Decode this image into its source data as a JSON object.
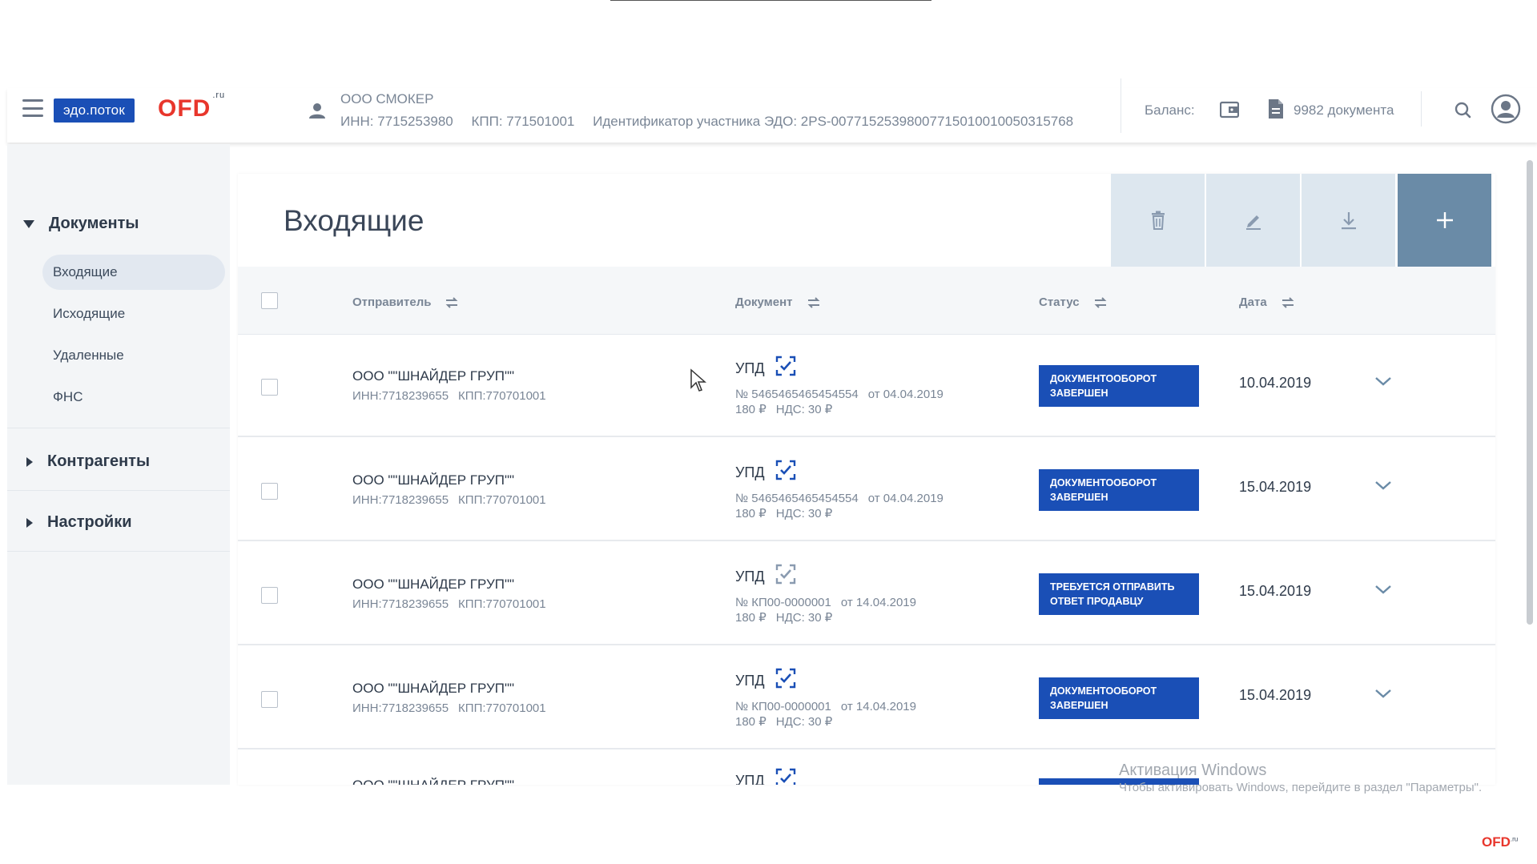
{
  "header": {
    "logo_edo": "эдо.поток",
    "logo_ofd": "OFD",
    "logo_ofd_suffix": ".ru",
    "org_name": "ООО СМОКЕР",
    "inn": "ИНН: 7715253980",
    "kpp": "КПП: 771501001",
    "edo_id": "Идентификатор участника ЭДО: 2PS-0077152539800771501001005031576​8",
    "balance_label": "Баланс:",
    "doc_count": "9982 документа"
  },
  "sidebar": {
    "documents": "Документы",
    "items": [
      {
        "label": "Входящие",
        "active": true
      },
      {
        "label": "Исходящие",
        "active": false
      },
      {
        "label": "Удаленные",
        "active": false
      },
      {
        "label": "ФНС",
        "active": false
      }
    ],
    "contractors": "Контрагенты",
    "settings": "Настройки"
  },
  "main": {
    "title": "Входящие",
    "columns": {
      "sender": "Отправитель",
      "document": "Документ",
      "status": "Статус",
      "date": "Дата"
    },
    "rows": [
      {
        "sender": "ООО \"\"ШНАЙДЕР ГРУП\"\"",
        "inn": "ИНН:7718239655",
        "kpp": "КПП:770701001",
        "doc_type": "УПД",
        "doc_num": "№ 5465465465454554",
        "doc_date": "от 04.04.2019",
        "amount": "180 ₽",
        "vat": "НДС: 30 ₽",
        "status_line1": "Документооборот",
        "status_line2": "завершен",
        "date": "10.04.2019"
      },
      {
        "sender": "ООО \"\"ШНАЙДЕР ГРУП\"\"",
        "inn": "ИНН:7718239655",
        "kpp": "КПП:770701001",
        "doc_type": "УПД",
        "doc_num": "№ 5465465465454554",
        "doc_date": "от 04.04.2019",
        "amount": "180 ₽",
        "vat": "НДС: 30 ₽",
        "status_line1": "Документооборот",
        "status_line2": "завершен",
        "date": "15.04.2019"
      },
      {
        "sender": "ООО \"\"ШНАЙДЕР ГРУП\"\"",
        "inn": "ИНН:7718239655",
        "kpp": "КПП:770701001",
        "doc_type": "УПД",
        "doc_num": "№ КП00-0000001",
        "doc_date": "от 14.04.2019",
        "amount": "180 ₽",
        "vat": "НДС: 30 ₽",
        "status_line1": "Требуется отправить",
        "status_line2": "ответ продавцу",
        "date": "15.04.2019"
      },
      {
        "sender": "ООО \"\"ШНАЙДЕР ГРУП\"\"",
        "inn": "ИНН:7718239655",
        "kpp": "КПП:770701001",
        "doc_type": "УПД",
        "doc_num": "№ КП00-0000001",
        "doc_date": "от 14.04.2019",
        "amount": "180 ₽",
        "vat": "НДС: 30 ₽",
        "status_line1": "Документооборот",
        "status_line2": "завершен",
        "date": "15.04.2019"
      }
    ],
    "partial_row": {
      "sender": "ООО \"\"ШНАЙДЕР ГРУП\"\"",
      "doc_type": "УПД"
    }
  },
  "watermark": {
    "title": "Активация Windows",
    "subtitle": "Чтобы активировать Windows, перейдите в раздел \"Параметры\"."
  },
  "footer_logo": {
    "text": "OFD",
    "suffix": ".ru"
  },
  "colors": {
    "brand_blue": "#1a4fb6",
    "brand_red": "#e8362c",
    "add_button": "#6a8ba7",
    "toolbar_button": "#dde7ef"
  }
}
